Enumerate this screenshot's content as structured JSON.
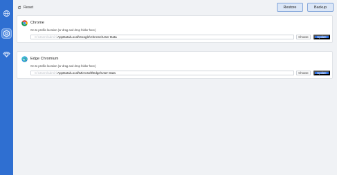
{
  "toolbar": {
    "reset_label": "Reset",
    "restore_label": "Restore",
    "backup_label": "Backup"
  },
  "sidebar": {
    "items": [
      {
        "icon": "globe-icon",
        "active": false
      },
      {
        "icon": "hexagon-icon",
        "active": true
      },
      {
        "icon": "diamond-icon",
        "active": false
      }
    ]
  },
  "browsers": [
    {
      "name": "Chrome",
      "icon": "chrome-icon",
      "hint": "Go to profile location (or drag and drop folder here)",
      "path_prefix": "C:\\Users\\admin\\",
      "path_visible": "AppData\\Local\\Google\\Chrome\\User Data",
      "choose_label": "Choose",
      "update_label": "Update"
    },
    {
      "name": "Edge Chromium",
      "icon": "edge-icon",
      "hint": "Go to profile location (or drag and drop folder here)",
      "path_prefix": "C:\\Users\\admin\\",
      "path_visible": "AppData\\Local\\Microsoft\\Edge\\User Data",
      "choose_label": "Choose",
      "update_label": "Update"
    }
  ],
  "colors": {
    "sidebar": "#2f6fd1",
    "accent": "#2d6ee0",
    "background": "#f0f2f5"
  }
}
